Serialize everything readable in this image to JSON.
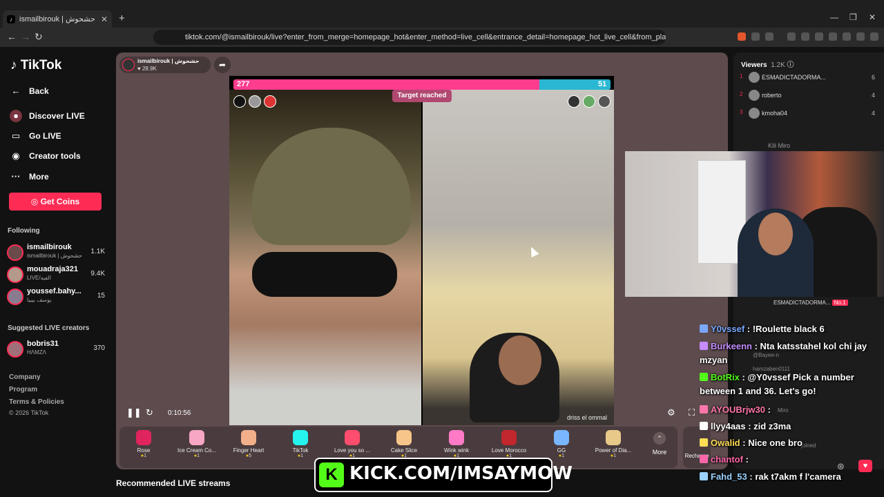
{
  "browser": {
    "tab_title": "ismailbirouk | حشحوش ",
    "tab_close": "✕",
    "new_tab": "+",
    "url": "tiktok.com/@ismailbirouk/live?enter_from_merge=homepage_hot&enter_method=live_cell&entrance_detail=homepage_hot_live_cell&from_pla..."
  },
  "sidebar": {
    "logo": "TikTok",
    "nav": [
      "Back",
      "Discover LIVE",
      "Go LIVE",
      "Creator tools",
      "More"
    ],
    "get_coins": "Get Coins",
    "following_title": "Following",
    "following": [
      {
        "name": "ismailbirouk",
        "sub": "ismailbirouk | حشحوش",
        "count": "1.1K"
      },
      {
        "name": "mouadraja321",
        "sub": "LIVE/الفيه",
        "count": "9.4K"
      },
      {
        "name": "youssef.bahy...",
        "sub": "يوسف بيبيا",
        "count": "15"
      }
    ],
    "suggested_title": "Suggested LIVE creators",
    "suggested": [
      {
        "name": "bobris31",
        "sub": "HΛMZΛ",
        "count": "370"
      }
    ],
    "footer": [
      "Company",
      "Program",
      "Terms & Policies",
      "© 2026 TikTok"
    ]
  },
  "host": {
    "name": "ismailbirouk | حشحوش",
    "likes": "28.9K"
  },
  "battle": {
    "score_left": "277",
    "score_right": "51",
    "score_left_value": 277,
    "score_right_value": 51,
    "target": "Target reached",
    "right_tag": "driss el ommal"
  },
  "player": {
    "timer": "0:10:56"
  },
  "gifts": [
    {
      "name": "Rose",
      "cost": "1",
      "color": "#e0245e"
    },
    {
      "name": "Ice Cream Co...",
      "cost": "1",
      "color": "#f7a6c4"
    },
    {
      "name": "Finger Heart",
      "cost": "5",
      "color": "#f2b08a"
    },
    {
      "name": "TikTok",
      "cost": "1",
      "color": "#25f4ee"
    },
    {
      "name": "Love you so ...",
      "cost": "1",
      "color": "#ff4d6d"
    },
    {
      "name": "Cake Slice",
      "cost": "1",
      "color": "#f7c58a"
    },
    {
      "name": "Wink wink",
      "cost": "1",
      "color": "#ff7ac6"
    },
    {
      "name": "Love Morocco",
      "cost": "1",
      "color": "#c1272d"
    },
    {
      "name": "GG",
      "cost": "1",
      "color": "#7ab6ff"
    },
    {
      "name": "Power of Dia...",
      "cost": "1",
      "color": "#e8c98a"
    }
  ],
  "gifts_more": "More",
  "recharge": "Recharge",
  "recommended": "Recommended LIVE streams",
  "viewers": {
    "title": "Viewers",
    "count": "1.2K",
    "list": [
      {
        "rank": "1",
        "name": "ESMADICTADORMA...",
        "count": "6"
      },
      {
        "rank": "2",
        "name": "roberto",
        "count": "4"
      },
      {
        "rank": "3",
        "name": "kmoha04",
        "count": "4"
      }
    ],
    "extra": "Kili Miro"
  },
  "chat_user": "ESMADICTADORMA...",
  "chat_badge": "No.1",
  "chat": [
    {
      "user": "Y0vssef",
      "text": "!Roulette black 6",
      "color": "#7aa8ff"
    },
    {
      "user": "Burkeenn",
      "text": "Nta katsstahel kol chi jay mzyan",
      "color": "#c58cff"
    },
    {
      "user": "BotRix",
      "text": "@Y0vssef Pick a number between 1 and 36. Let's go!",
      "color": "#53fc18"
    },
    {
      "user": "AYOUBrjw30",
      "text": "",
      "color": "#ff77aa"
    },
    {
      "user": "llyy4aas",
      "text": "zid z3ma",
      "color": "#ffffff"
    },
    {
      "user": "Owalid",
      "text": "Nice one bro",
      "color": "#ffdd55"
    },
    {
      "user": "chantof",
      "text": "",
      "color": "#ff66aa"
    },
    {
      "user": "Fahd_53",
      "text": "rak t7akm f l'camera",
      "color": "#9ad1ff"
    }
  ],
  "chat_ghost": [
    "@Bayee-n",
    "hamzaben0111",
    "Miro",
    "joined"
  ],
  "kick": {
    "logo": "K",
    "text": "KICK.COM/IMSAYMOW"
  }
}
